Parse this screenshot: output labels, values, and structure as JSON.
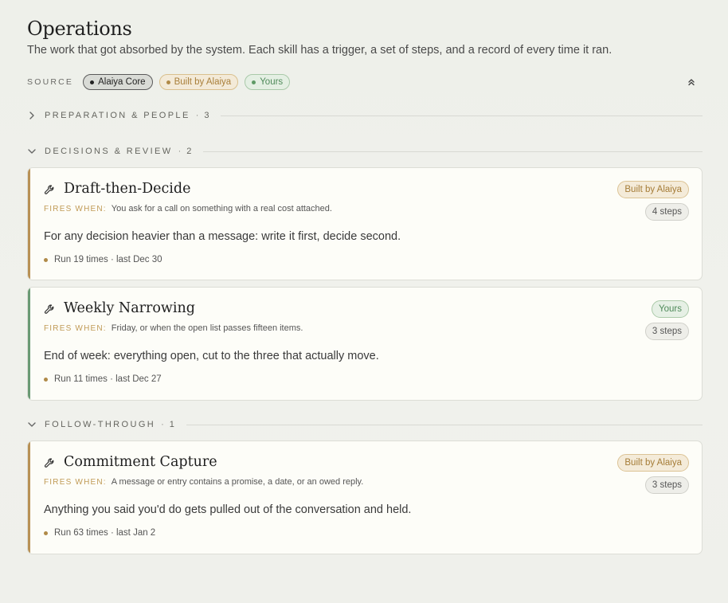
{
  "header": {
    "title": "Operations",
    "subtitle": "The work that got absorbed by the system. Each skill has a trigger, a set of steps, and a record of every time it ran."
  },
  "source": {
    "label": "SOURCE",
    "chips": [
      "Alaiya Core",
      "Built by Alaiya",
      "Yours"
    ]
  },
  "sections": [
    {
      "label": "PREPARATION & PEOPLE",
      "count": "3",
      "expanded": false
    },
    {
      "label": "DECISIONS & REVIEW",
      "count": "2",
      "expanded": true
    },
    {
      "label": "FOLLOW-THROUGH",
      "count": "1",
      "expanded": true
    }
  ],
  "separator": "·",
  "fires_label": "FIRES WHEN:",
  "cards": [
    {
      "title": "Draft-then-Decide",
      "fires": "You ask for a call on something with a real cost attached.",
      "description": "For any decision heavier than a message: write it first, decide second.",
      "runs": "Run 19 times · last Dec 30",
      "badge": "Built by Alaiya",
      "steps": "4 steps"
    },
    {
      "title": "Weekly Narrowing",
      "fires": "Friday, or when the open list passes fifteen items.",
      "description": "End of week: everything open, cut to the three that actually move.",
      "runs": "Run 11 times · last Dec 27",
      "badge": "Yours",
      "steps": "3 steps"
    },
    {
      "title": "Commitment Capture",
      "fires": "A message or entry contains a promise, a date, or an owed reply.",
      "description": "Anything you said you'd do gets pulled out of the conversation and held.",
      "runs": "Run 63 times · last Jan 2",
      "badge": "Built by Alaiya",
      "steps": "3 steps"
    }
  ],
  "colors": {
    "alaiya_accent": "#b89155",
    "yours_accent": "#6a9a74",
    "background": "#eff0eb"
  }
}
